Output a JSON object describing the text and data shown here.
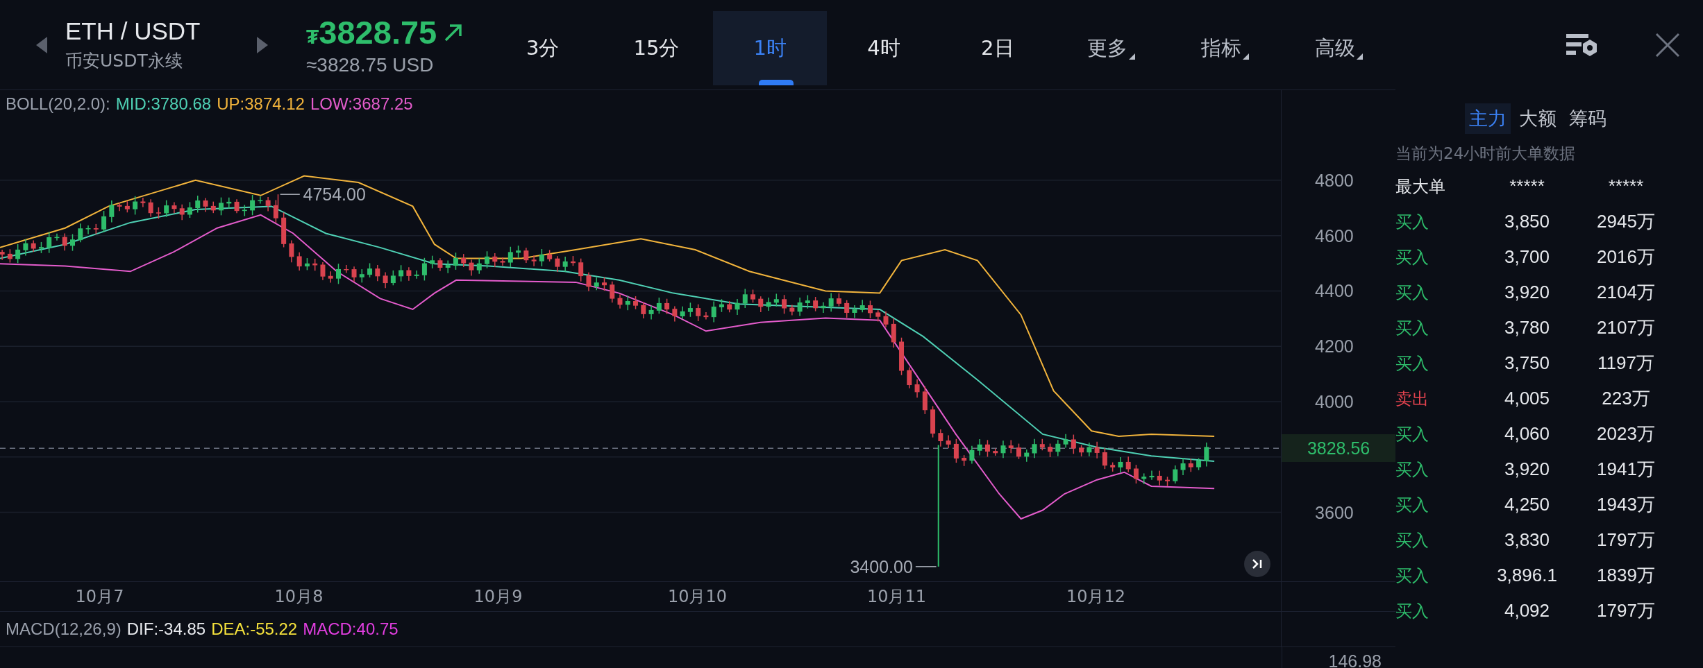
{
  "header": {
    "pair": "ETH / USDT",
    "market": "币安USDT永续",
    "currency_symbol": "₮",
    "price": "3828.75",
    "price_usd": "≈3828.75 USD"
  },
  "intervals": [
    {
      "label": "3分",
      "selected": false
    },
    {
      "label": "15分",
      "selected": false
    },
    {
      "label": "1时",
      "selected": true
    },
    {
      "label": "4时",
      "selected": false
    },
    {
      "label": "2日",
      "selected": false
    }
  ],
  "menus": [
    {
      "label": "更多"
    },
    {
      "label": "指标"
    },
    {
      "label": "高级"
    }
  ],
  "boll_legend": [
    {
      "text": "BOLL(20,2.0):",
      "color": "#9ba1ad"
    },
    {
      "text": "MID:3780.68",
      "color": "#4fd1b5"
    },
    {
      "text": "UP:3874.12",
      "color": "#f2b43c"
    },
    {
      "text": "LOW:3687.25",
      "color": "#e45ccc"
    }
  ],
  "price_chart": {
    "y_axis": [
      "4800",
      "4600",
      "4400",
      "4200",
      "4000",
      "3600"
    ],
    "high_label": "4754.00",
    "low_label": "3400.00",
    "last_price": "3828.56",
    "dates": [
      "10月7",
      "10月8",
      "10月9",
      "10月10",
      "10月11",
      "10月12"
    ]
  },
  "macd_legend": [
    {
      "text": "MACD(12,26,9)",
      "color": "#9ba1ad"
    },
    {
      "text": "DIF:-34.85",
      "color": "#e8eaee"
    },
    {
      "text": "DEA:-55.22",
      "color": "#f5e23c"
    },
    {
      "text": "MACD:40.75",
      "color": "#e23ee0"
    }
  ],
  "macd_axis": "146.98",
  "big_orders": {
    "tabs": [
      {
        "label": "主力",
        "selected": true
      },
      {
        "label": "大额",
        "selected": false
      },
      {
        "label": "筹码",
        "selected": false
      }
    ],
    "note": "当前为24小时前大单数据",
    "columns": [
      "最大单",
      "*****",
      "*****"
    ],
    "rows": [
      {
        "side": "买入",
        "kind": "buy",
        "price": "3,850",
        "amount": "2945万"
      },
      {
        "side": "买入",
        "kind": "buy",
        "price": "3,700",
        "amount": "2016万"
      },
      {
        "side": "买入",
        "kind": "buy",
        "price": "3,920",
        "amount": "2104万"
      },
      {
        "side": "买入",
        "kind": "buy",
        "price": "3,780",
        "amount": "2107万"
      },
      {
        "side": "买入",
        "kind": "buy",
        "price": "3,750",
        "amount": "1197万"
      },
      {
        "side": "卖出",
        "kind": "sell",
        "price": "4,005",
        "amount": "223万"
      },
      {
        "side": "买入",
        "kind": "buy",
        "price": "4,060",
        "amount": "2023万"
      },
      {
        "side": "买入",
        "kind": "buy",
        "price": "3,920",
        "amount": "1941万"
      },
      {
        "side": "买入",
        "kind": "buy",
        "price": "4,250",
        "amount": "1943万"
      },
      {
        "side": "买入",
        "kind": "buy",
        "price": "3,830",
        "amount": "1797万"
      },
      {
        "side": "买入",
        "kind": "buy",
        "price": "3,896.1",
        "amount": "1839万"
      },
      {
        "side": "买入",
        "kind": "buy",
        "price": "4,092",
        "amount": "1797万"
      }
    ]
  }
}
